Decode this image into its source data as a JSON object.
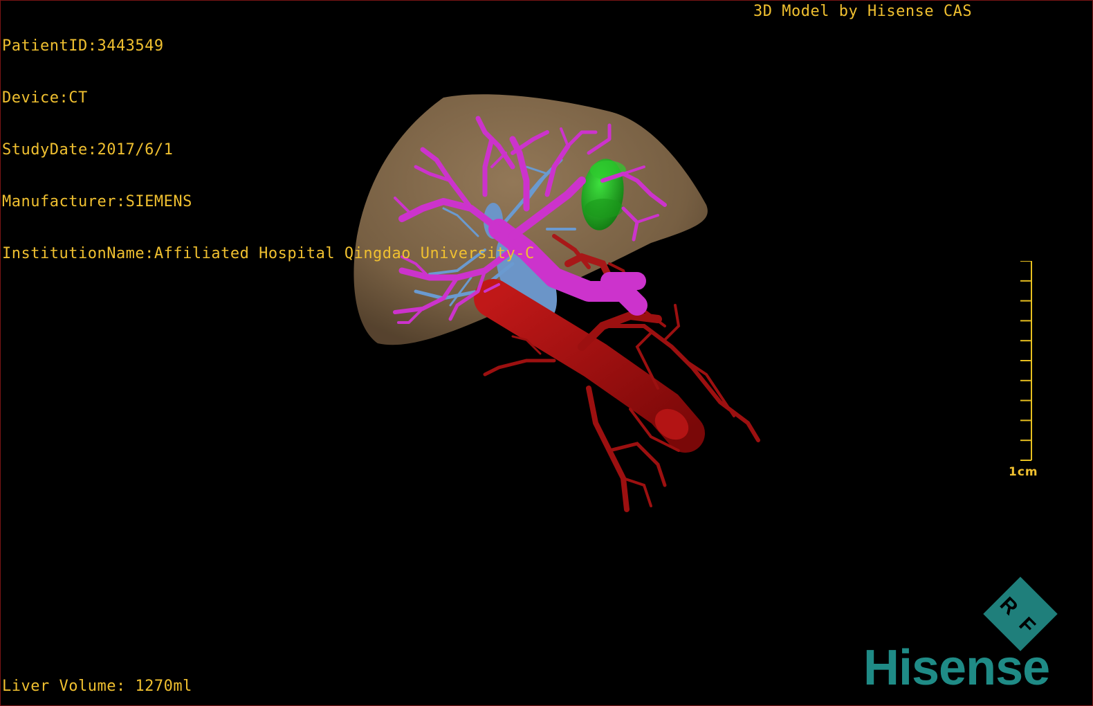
{
  "study_info": {
    "patient_id": "PatientID:3443549",
    "device": "Device:CT",
    "study_date": "StudyDate:2017/6/1",
    "manufacturer": "Manufacturer:SIEMENS",
    "institution": "InstitutionName:Affiliated Hospital Qingdao University-C"
  },
  "model_credit": "3D Model by Hisense CAS",
  "liver_volume": "Liver Volume: 1270ml",
  "scale": {
    "label": "1cm",
    "ticks": 10
  },
  "logo": {
    "brand": "Hisense",
    "badge_letters": [
      "R",
      "F"
    ]
  },
  "colors": {
    "overlay_text": "#f0c030",
    "liver": "#8a6e4e",
    "portal_vein": "#cc33cc",
    "hepatic_vein": "#6a9ad0",
    "artery": "#a01010",
    "tumor": "#22bb22",
    "brand": "#1f8b86"
  }
}
